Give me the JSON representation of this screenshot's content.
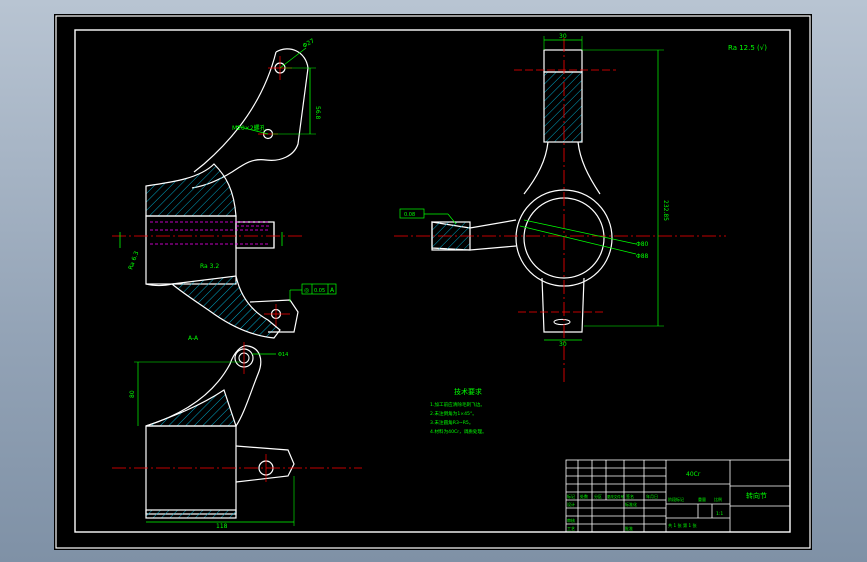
{
  "colors": {
    "background": "#000000",
    "frame": "#ffffff",
    "outline": "#ffffff",
    "dimension": "#00ff00",
    "centerline": "#ff0000",
    "hatch": "#00a8c8",
    "hidden": "#ff00ff",
    "annotation": "#00ffff",
    "textWhite": "#ffffff"
  },
  "views": {
    "side": {
      "dims": {
        "hole_dia": "Φ27",
        "arm_height": "56.8",
        "lower_hole": "M20×2螺孔"
      },
      "roughness_left": "Ra 6.3",
      "roughness_bottom": "Ra 3.2",
      "section_label": "A-A",
      "tolerance": {
        "sym": "◎",
        "val": "0.05",
        "datum": "A"
      }
    },
    "front": {
      "top_width": "30",
      "total_height": "232.85",
      "bore_dia": "Φ80",
      "outer_dia": "Φ88",
      "bottom_width": "30",
      "flat_dim": "0.08"
    },
    "bottom": {
      "height_dim": "80",
      "length_dim": "118",
      "slot_dim": "Φ14"
    }
  },
  "roughness_note": "Ra 12.5 (√)",
  "tech_req": {
    "title": "技术要求",
    "lines": [
      "1.加工前应清除毛刺飞边。",
      "2.未注倒角为1×45°。",
      "3.未注圆角R3~R5。",
      "4.材料为40Cr，调质处理。"
    ]
  },
  "title_block": {
    "material": "40Cr",
    "part_name": "转向节",
    "scale": "1:1",
    "sheet": "共 1 张  第 1 张",
    "labels": [
      "标记",
      "处数",
      "分区",
      "更改文件号",
      "签名",
      "年月日",
      "设计",
      "标准化",
      "审核",
      "工艺",
      "批准",
      "阶段标记",
      "重量",
      "比例"
    ]
  }
}
